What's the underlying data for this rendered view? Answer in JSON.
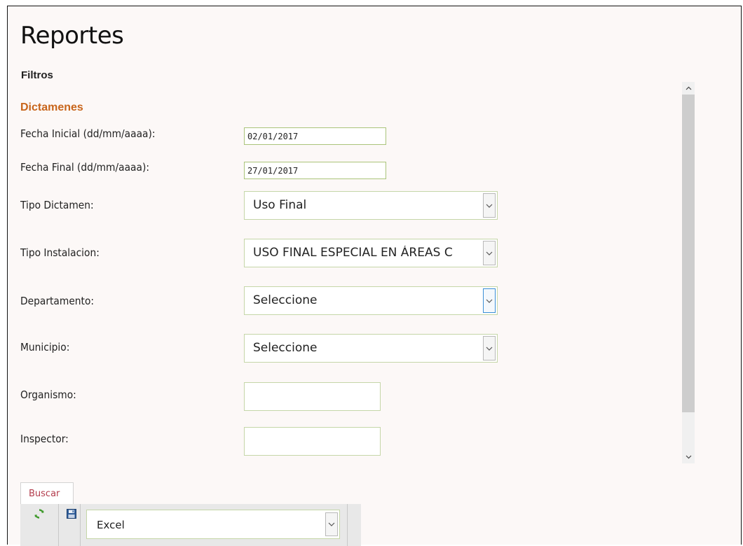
{
  "page": {
    "title": "Reportes",
    "filters_title": "Filtros"
  },
  "dictamenes": {
    "section_title": "Dictamenes",
    "fecha_inicial": {
      "label": "Fecha Inicial (dd/mm/aaaa):",
      "value": "02/01/2017"
    },
    "fecha_final": {
      "label": "Fecha Final (dd/mm/aaaa):",
      "value": "27/01/2017"
    },
    "tipo_dictamen": {
      "label": "Tipo Dictamen:",
      "value": "Uso Final"
    },
    "tipo_instalacion": {
      "label": "Tipo Instalacion:",
      "value": "USO FINAL ESPECIAL EN ÁREAS C"
    },
    "departamento": {
      "label": "Departamento:",
      "value": "Seleccione"
    },
    "municipio": {
      "label": "Municipio:",
      "value": "Seleccione"
    },
    "organismo": {
      "label": "Organismo:",
      "value": ""
    },
    "inspector": {
      "label": "Inspector:",
      "value": ""
    }
  },
  "tabs": [
    {
      "label": "Buscar"
    }
  ],
  "toolbar": {
    "refresh_icon": "refresh-icon",
    "save_icon": "save-icon",
    "export_format": "Excel"
  },
  "colors": {
    "section_title": "#c8651b",
    "tab_label": "#b33c4c",
    "input_border": "#c5d6a8",
    "focus_border": "#3b8fd6",
    "background": "#fcf8f7"
  }
}
